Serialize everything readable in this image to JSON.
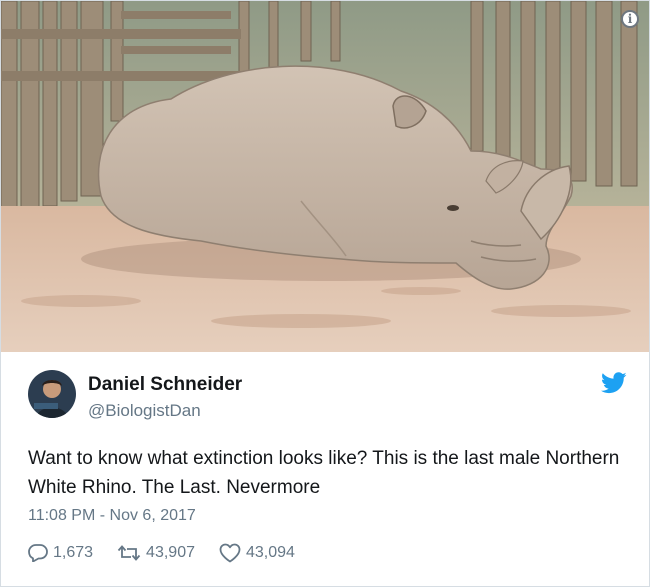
{
  "tweet": {
    "author_name": "Daniel Schneider",
    "author_handle": "@BiologistDan",
    "text": "Want to know what extinction looks like? This is the last male Northern White Rhino. The Last. Nevermore",
    "timestamp": "11:08 PM - Nov 6, 2017",
    "replies": "1,673",
    "retweets": "43,907",
    "likes": "43,094"
  },
  "colors": {
    "twitter_blue": "#1da1f2",
    "secondary_text": "#657786",
    "primary_text": "#14171a"
  },
  "icons": [
    "info-icon",
    "twitter-bird-icon",
    "reply-icon",
    "retweet-icon",
    "like-icon"
  ]
}
